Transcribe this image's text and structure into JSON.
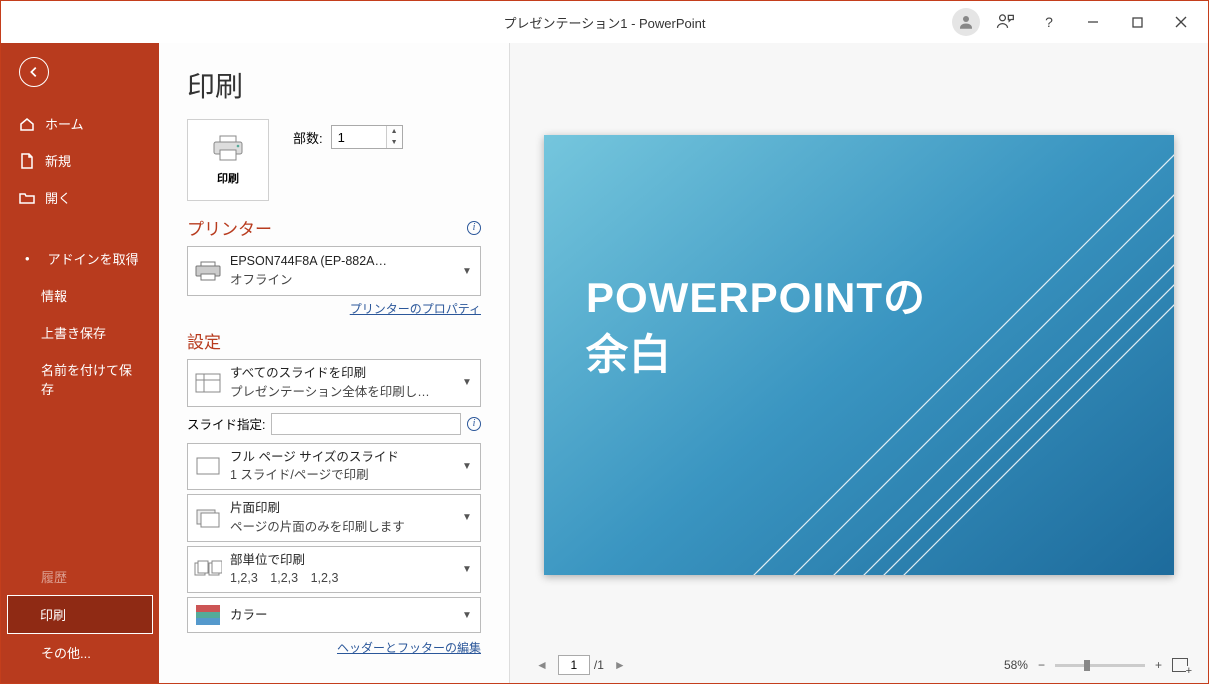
{
  "titlebar": {
    "title": "プレゼンテーション1 - PowerPoint",
    "help": "?"
  },
  "sidebar": {
    "home": "ホーム",
    "new": "新規",
    "open": "開く",
    "getaddins": "アドインを取得",
    "info": "情報",
    "save": "上書き保存",
    "saveas": "名前を付けて保存",
    "history": "履歴",
    "print": "印刷",
    "more": "その他..."
  },
  "center": {
    "pageTitle": "印刷",
    "printBtn": "印刷",
    "copiesLabel": "部数:",
    "copiesValue": "1",
    "printerSection": "プリンター",
    "printer": {
      "name": "EPSON744F8A (EP-882A…",
      "status": "オフライン"
    },
    "printerProps": "プリンターのプロパティ",
    "settingsSection": "設定",
    "whichSlides": {
      "line1": "すべてのスライドを印刷",
      "line2": "プレゼンテーション全体を印刷し…"
    },
    "slideSpecLabel": "スライド指定:",
    "layout": {
      "line1": "フル ページ サイズのスライド",
      "line2": "1 スライド/ページで印刷"
    },
    "duplex": {
      "line1": "片面印刷",
      "line2": "ページの片面のみを印刷します"
    },
    "collate": {
      "line1": "部単位で印刷",
      "line2": "1,2,3　1,2,3　1,2,3"
    },
    "color": {
      "line1": "カラー"
    },
    "headerFooter": "ヘッダーとフッターの編集"
  },
  "preview": {
    "slideTitle1": "POWERPOINTの",
    "slideTitle2": "余白",
    "page": "1",
    "total": "/1",
    "zoom": "58%"
  }
}
